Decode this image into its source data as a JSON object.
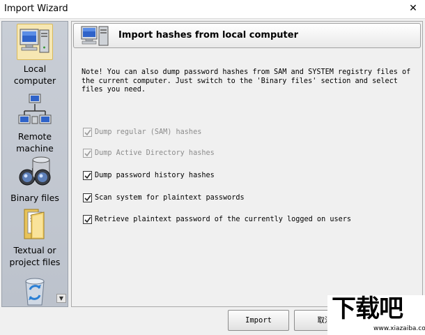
{
  "window": {
    "title": "Import Wizard",
    "close_glyph": "✕"
  },
  "sidebar": {
    "items": [
      {
        "label": "Local\ncomputer",
        "icon": "computer-icon",
        "selected": true
      },
      {
        "label": "Remote\nmachine",
        "icon": "network-icon",
        "selected": false
      },
      {
        "label": "Binary files",
        "icon": "binoculars-icon",
        "selected": false
      },
      {
        "label": "Textual or\nproject files",
        "icon": "folder-icon",
        "selected": false
      },
      {
        "label": "",
        "icon": "recycle-bin-icon",
        "selected": false
      }
    ],
    "scroll_glyph": "▼"
  },
  "main": {
    "header_title": "Import hashes from local computer",
    "note": "Note! You can also dump password hashes from SAM and SYSTEM registry files of\nthe current computer. Just switch to the 'Binary files' section and select\nfiles you need.",
    "options": [
      {
        "label": "Dump regular (SAM) hashes",
        "checked": true,
        "enabled": false
      },
      {
        "label": "Dump Active Directory hashes",
        "checked": true,
        "enabled": false
      },
      {
        "label": "Dump password history hashes",
        "checked": true,
        "enabled": true
      },
      {
        "label": "Scan system for plaintext passwords",
        "checked": true,
        "enabled": true
      },
      {
        "label": "Retrieve plaintext password of the currently logged on users",
        "checked": true,
        "enabled": true
      }
    ]
  },
  "footer": {
    "import_label": "Import",
    "cancel_label": "取消"
  },
  "watermark": {
    "main": "下载吧",
    "url": "www.xiazaiba.com"
  }
}
